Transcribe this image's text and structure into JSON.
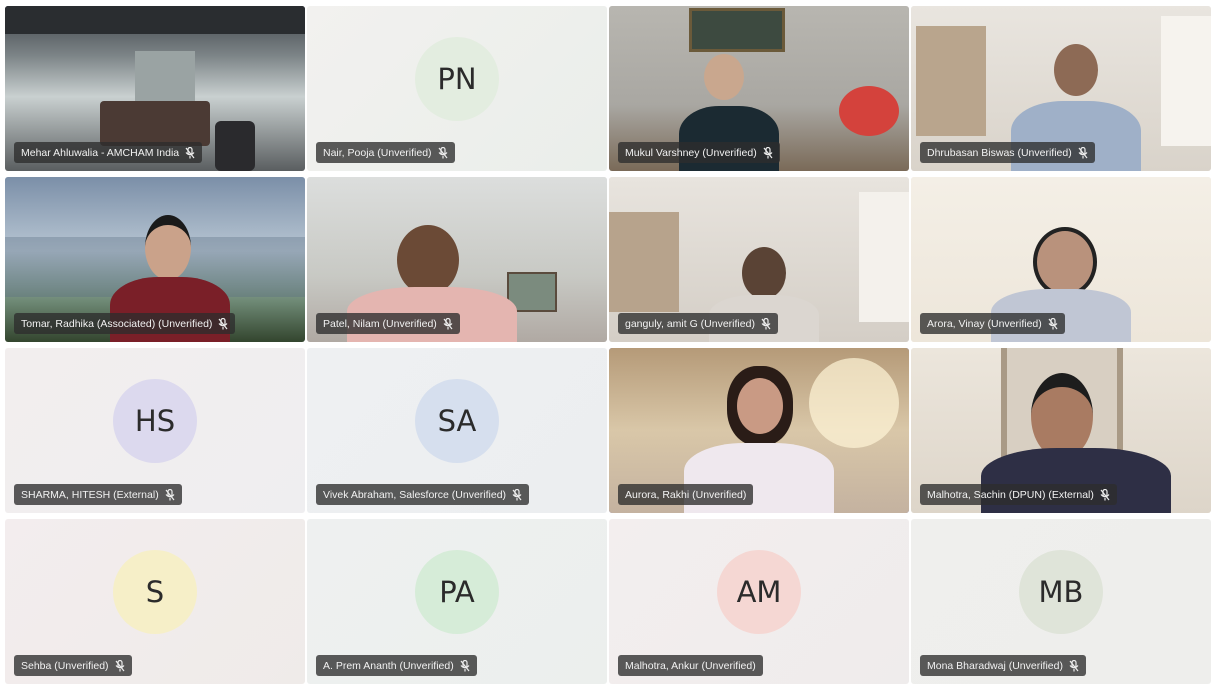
{
  "participants": [
    {
      "name": "Mehar Ahluwalia - AMCHAM India",
      "type": "video",
      "scene": "office"
    },
    {
      "name": "Nair, Pooja (Unverified)",
      "type": "avatar",
      "initials": "PN",
      "avatar_color": "#e3ede0"
    },
    {
      "name": "Mukul Varshney (Unverified)",
      "type": "video",
      "scene": "stonewall"
    },
    {
      "name": "Dhrubasan Biswas (Unverified)",
      "type": "video",
      "scene": "bright-room"
    },
    {
      "name": "Tomar, Radhika (Associated) (Unverified)",
      "type": "video",
      "scene": "mountains"
    },
    {
      "name": "Patel, Nilam (Unverified)",
      "type": "video",
      "scene": "ceiling-room"
    },
    {
      "name": "ganguly, amit G (Unverified)",
      "type": "video",
      "scene": "living-room"
    },
    {
      "name": "Arora, Vinay (Unverified)",
      "type": "video",
      "scene": "plain-wall"
    },
    {
      "name": "SHARMA, HITESH (External)",
      "type": "avatar",
      "initials": "HS",
      "avatar_color": "#dcd9ee"
    },
    {
      "name": "Vivek Abraham, Salesforce (Unverified)",
      "type": "avatar",
      "initials": "SA",
      "avatar_color": "#d6dfee"
    },
    {
      "name": "Aurora, Rakhi (Unverified)",
      "type": "video",
      "scene": "warm-room",
      "active_speaker": true
    },
    {
      "name": "Malhotra, Sachin (DPUN) (External)",
      "type": "video",
      "scene": "doorway"
    },
    {
      "name": "Sehba (Unverified)",
      "type": "avatar",
      "initials": "S",
      "avatar_color": "#f6efc8"
    },
    {
      "name": "A. Prem Ananth (Unverified)",
      "type": "avatar",
      "initials": "PA",
      "avatar_color": "#d6ecd8"
    },
    {
      "name": "Malhotra, Ankur (Unverified)",
      "type": "avatar",
      "initials": "AM",
      "avatar_color": "#f5d7d3"
    },
    {
      "name": "Mona Bharadwaj (Unverified)",
      "type": "avatar",
      "initials": "MB",
      "avatar_color": "#dfe4d9"
    }
  ],
  "colors": {
    "active_speaker_outline": "#7b83eb",
    "nameplate_bg": "#2d2d2d",
    "tile_bg": "#ece8ea"
  },
  "icons": {
    "nameplate_icon": "microphone-muted-icon"
  }
}
